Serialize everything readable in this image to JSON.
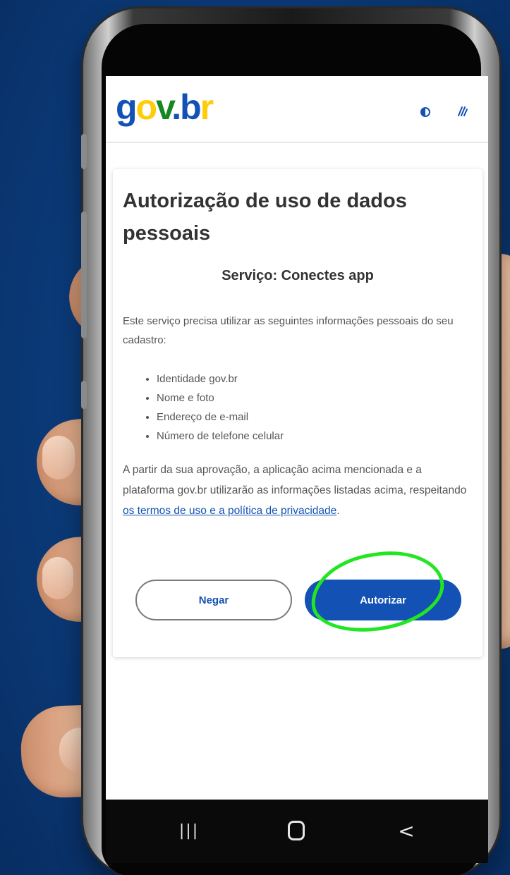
{
  "header": {
    "logo": {
      "g": "g",
      "o": "o",
      "v": "v",
      "dot": ".",
      "b": "b",
      "r": "r"
    },
    "icons": [
      "contrast-icon",
      "vlibras-hands-icon"
    ]
  },
  "card": {
    "title": "Autorização de uso de dados pessoais",
    "service": "Serviço: Conectes app",
    "intro": "Este serviço precisa utilizar as seguintes informações pessoais do seu cadastro:",
    "items": [
      "Identidade gov.br",
      "Nome e foto",
      "Endereço de e-mail",
      "Número de telefone celular"
    ],
    "approval_text": "A partir da sua aprovação, a aplicação acima mencionada e a plataforma gov.br utilizarão as informações listadas acima, respeitando ",
    "approval_link": "os termos de uso e a política de privacidade",
    "approval_end": "."
  },
  "buttons": {
    "deny": "Negar",
    "authorize": "Autorizar"
  },
  "navbar": {
    "recents": "|||",
    "back": "<"
  },
  "colors": {
    "primary": "#1351b4",
    "highlight": "#22e622",
    "background": "#0b3a78"
  }
}
